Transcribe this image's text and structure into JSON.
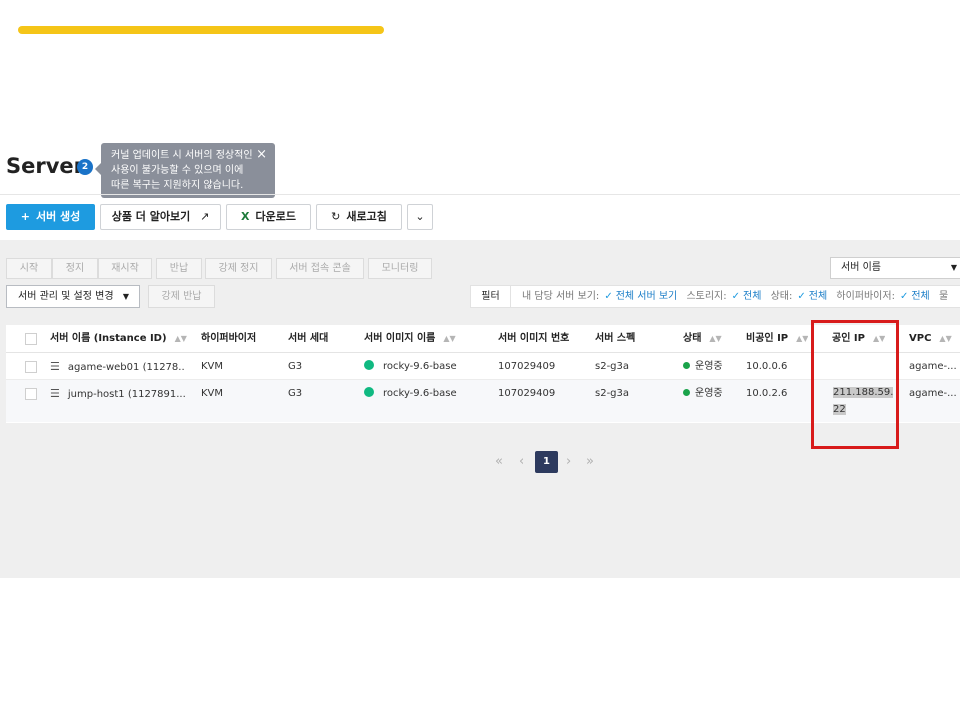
{
  "header": {
    "title": "Server",
    "count": "2",
    "tooltip": {
      "lines": [
        "커널 업데이트 시 서버의 정상적인",
        "사용이 불가능할 수 있으며 이에",
        "따른 복구는 지원하지 않습니다."
      ],
      "close": "×"
    }
  },
  "toolbar": {
    "create": "서버 생성",
    "learn_more": "상품 더 알아보기",
    "download": "다운로드",
    "refresh": "새로고침",
    "more": "⌄"
  },
  "actions": {
    "items": [
      "시작",
      "정지",
      "재시작",
      "반납",
      "강제 정지",
      "서버 접속 콘솔",
      "모니터링"
    ],
    "search_field": "서버 이름",
    "manage": "서버 관리 및 설정 변경",
    "force_return": "강제 반납"
  },
  "filter": {
    "label": "필터",
    "items": [
      {
        "key": "내 담당 서버 보기:",
        "value": "전체 서버 보기"
      },
      {
        "key": "스토리지:",
        "value": "전체"
      },
      {
        "key": "상태:",
        "value": "전체"
      },
      {
        "key": "하이퍼바이저:",
        "value": "전체"
      }
    ],
    "overflow": "물"
  },
  "table": {
    "columns": [
      "서버 이름 (Instance ID)",
      "하이퍼바이저",
      "서버 세대",
      "서버 이미지 이름",
      "서버 이미지 번호",
      "서버 스펙",
      "상태",
      "비공인 IP",
      "공인 IP",
      "VPC"
    ],
    "rows": [
      {
        "name": "agame-web01 (11278...",
        "hypervisor": "KVM",
        "generation": "G3",
        "image": "rocky-9.6-base",
        "image_no": "107029409",
        "spec": "s2-g3a",
        "status": "운영중",
        "private_ip": "10.0.0.6",
        "public_ip": "",
        "vpc": "agame-..."
      },
      {
        "name": "jump-host1 (1127891...",
        "hypervisor": "KVM",
        "generation": "G3",
        "image": "rocky-9.6-base",
        "image_no": "107029409",
        "spec": "s2-g3a",
        "status": "운영중",
        "private_ip": "10.0.2.6",
        "public_ip_line1": "211.188.59.",
        "public_ip_line2": "22",
        "vpc": "agame-..."
      }
    ]
  },
  "pagination": {
    "first": "«",
    "prev": "‹",
    "current": "1",
    "next": "›",
    "last": "»"
  },
  "colors": {
    "accent": "#1e9be0",
    "highlight_box": "#d81b1b",
    "status_running": "#1aa34a",
    "banner": "#f5c518"
  }
}
